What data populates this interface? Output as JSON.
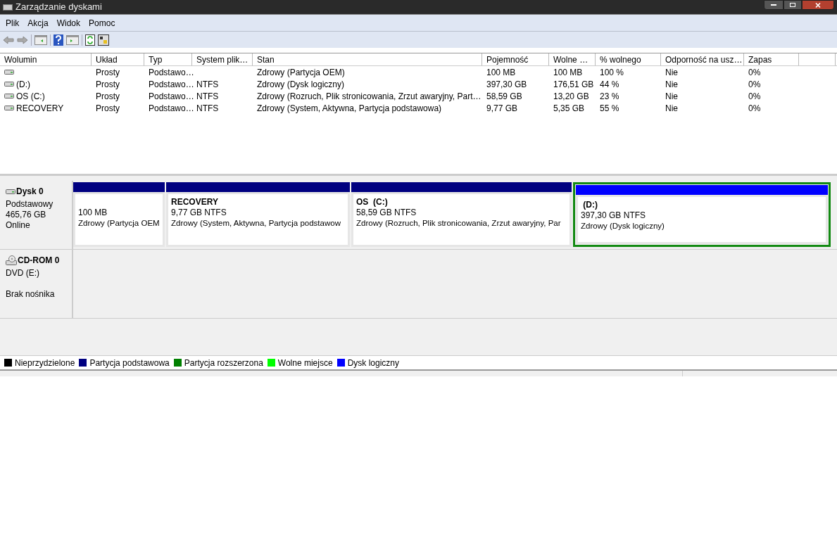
{
  "window": {
    "title": "Zarządzanie dyskami"
  },
  "menu": [
    "Plik",
    "Akcja",
    "Widok",
    "Pomoc"
  ],
  "table": {
    "columns": [
      "Wolumin",
      "Układ",
      "Typ",
      "System plik…",
      "Stan",
      "Pojemność",
      "Wolne …",
      "% wolnego",
      "Odporność na usz…",
      "Zapas"
    ],
    "rows": [
      {
        "cells": [
          "",
          "Prosty",
          "Podstawo…",
          "",
          "Zdrowy (Partycja OEM)",
          "100 MB",
          "100 MB",
          "100 %",
          "Nie",
          "0%"
        ]
      },
      {
        "cells": [
          "(D:)",
          "Prosty",
          "Podstawo…",
          "NTFS",
          "Zdrowy (Dysk logiczny)",
          "397,30 GB",
          "176,51 GB",
          "44 %",
          "Nie",
          "0%"
        ]
      },
      {
        "cells": [
          "OS (C:)",
          "Prosty",
          "Podstawo…",
          "NTFS",
          "Zdrowy (Rozruch, Plik stronicowania, Zrzut awaryjny, Part…",
          "58,59 GB",
          "13,20 GB",
          "23 %",
          "Nie",
          "0%"
        ]
      },
      {
        "cells": [
          "RECOVERY",
          "Prosty",
          "Podstawo…",
          "NTFS",
          "Zdrowy (System, Aktywna, Partycja podstawowa)",
          "9,77 GB",
          "5,35 GB",
          "55 %",
          "Nie",
          "0%"
        ]
      }
    ]
  },
  "disks": [
    {
      "kind": "disk",
      "name": "Dysk 0",
      "lines": [
        "Podstawowy",
        "465,76 GB"
      ],
      "state": "Online",
      "partitions": [
        {
          "size": "100 MB",
          "status": "Zdrowy (Partycja OEM",
          "color": "#000080",
          "selected": false
        },
        {
          "label": "RECOVERY",
          "size": "9,77 GB NTFS",
          "status": "Zdrowy (System, Aktywna, Partycja podstawow",
          "color": "#000080",
          "selected": false
        },
        {
          "label": "OS  (C:)",
          "size": "58,59 GB NTFS",
          "status": "Zdrowy (Rozruch, Plik stronicowania, Zrzut awaryjny, Par",
          "color": "#000080",
          "selected": false
        },
        {
          "label": " (D:)",
          "size": "397,30 GB NTFS",
          "status": "Zdrowy (Dysk logiczny)",
          "color": "#0000ff",
          "selected": true
        }
      ]
    },
    {
      "kind": "cdrom",
      "name": "CD-ROM 0",
      "lines": [
        "DVD (E:)"
      ],
      "state": "Brak nośnika"
    }
  ],
  "legend": [
    {
      "label": "Nieprzydzielone",
      "color": "#000000"
    },
    {
      "label": "Partycja podstawowa",
      "color": "#000080"
    },
    {
      "label": "Partycja rozszerzona",
      "color": "#008000"
    },
    {
      "label": "Wolne miejsce",
      "color": "#00ff00"
    },
    {
      "label": "Dysk logiczny",
      "color": "#0000ff"
    }
  ]
}
